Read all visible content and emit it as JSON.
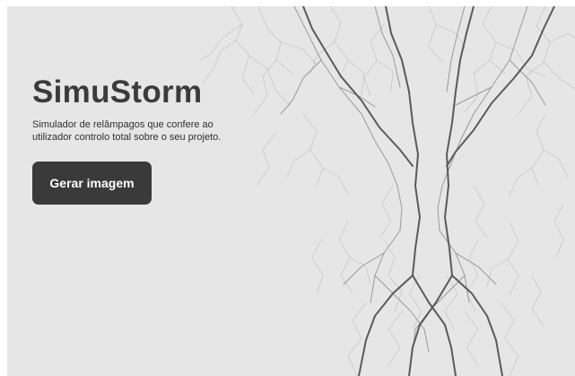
{
  "hero": {
    "title": "SimuStorm",
    "subtitle": "Simulador de relâmpagos que confere ao utilizador controlo total sobre o seu projeto.",
    "cta_label": "Gerar imagem"
  },
  "colors": {
    "background": "#e6e6e6",
    "title": "#3b3b3b",
    "button": "#3a3a3a",
    "button_text": "#ffffff",
    "lightning": "#5a5a5a"
  },
  "icons": [
    "lightning-illustration"
  ]
}
